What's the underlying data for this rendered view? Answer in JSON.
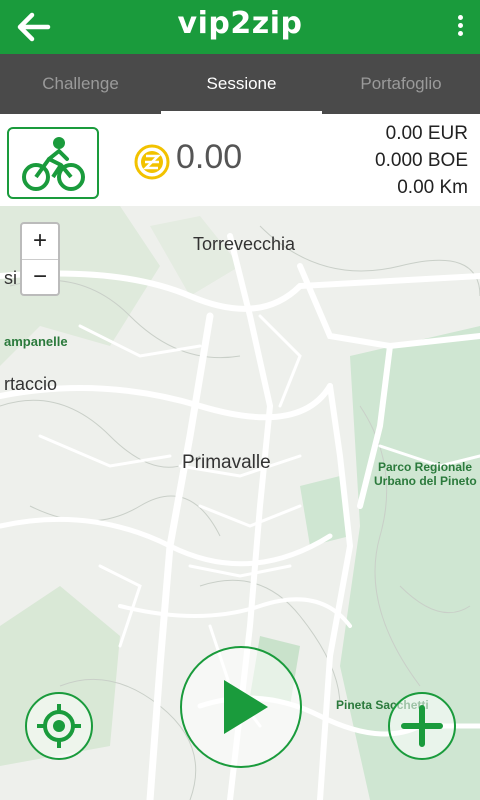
{
  "app": {
    "title": "vip2zip"
  },
  "colors": {
    "brand": "#1a9b3c",
    "tab_bg": "#4a4a4a",
    "coin": "#f2c200"
  },
  "tabs": [
    {
      "label": "Challenge",
      "active": false
    },
    {
      "label": "Sessione",
      "active": true
    },
    {
      "label": "Portafoglio",
      "active": false
    }
  ],
  "stats": {
    "balance": "0.00",
    "eur": "0.00 EUR",
    "boe": "0.000 BOE",
    "km": "0.00 Km"
  },
  "map": {
    "zoom_in": "+",
    "zoom_out": "−",
    "labels": {
      "torrevecchia": "Torrevecchia",
      "primavalle": "Primavalle",
      "si": "si",
      "campanelle": "ampanelle",
      "ortaccio": "rtaccio",
      "parco1": "Parco Regionale",
      "parco2": "Urbano del Pineto",
      "pineta": "Pineta Sacchetti"
    }
  },
  "icons": {
    "back": "arrow-left-icon",
    "menu": "kebab-menu-icon",
    "bike": "bicycle-icon",
    "coin": "coin-icon",
    "locate": "crosshair-icon",
    "play": "play-icon",
    "add": "plus-icon"
  }
}
